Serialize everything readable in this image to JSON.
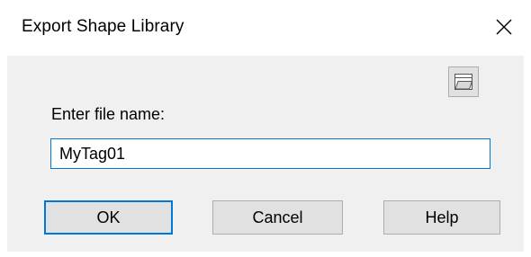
{
  "window": {
    "title": "Export Shape Library"
  },
  "form": {
    "label": "Enter file name:",
    "file_name_value": "MyTag01",
    "browse_icon": "folder-browse-icon"
  },
  "buttons": {
    "ok": "OK",
    "cancel": "Cancel",
    "help": "Help"
  },
  "colors": {
    "accent": "#0078d7",
    "button_face": "#e1e1e1",
    "dialog_background": "#f0f0f0"
  }
}
